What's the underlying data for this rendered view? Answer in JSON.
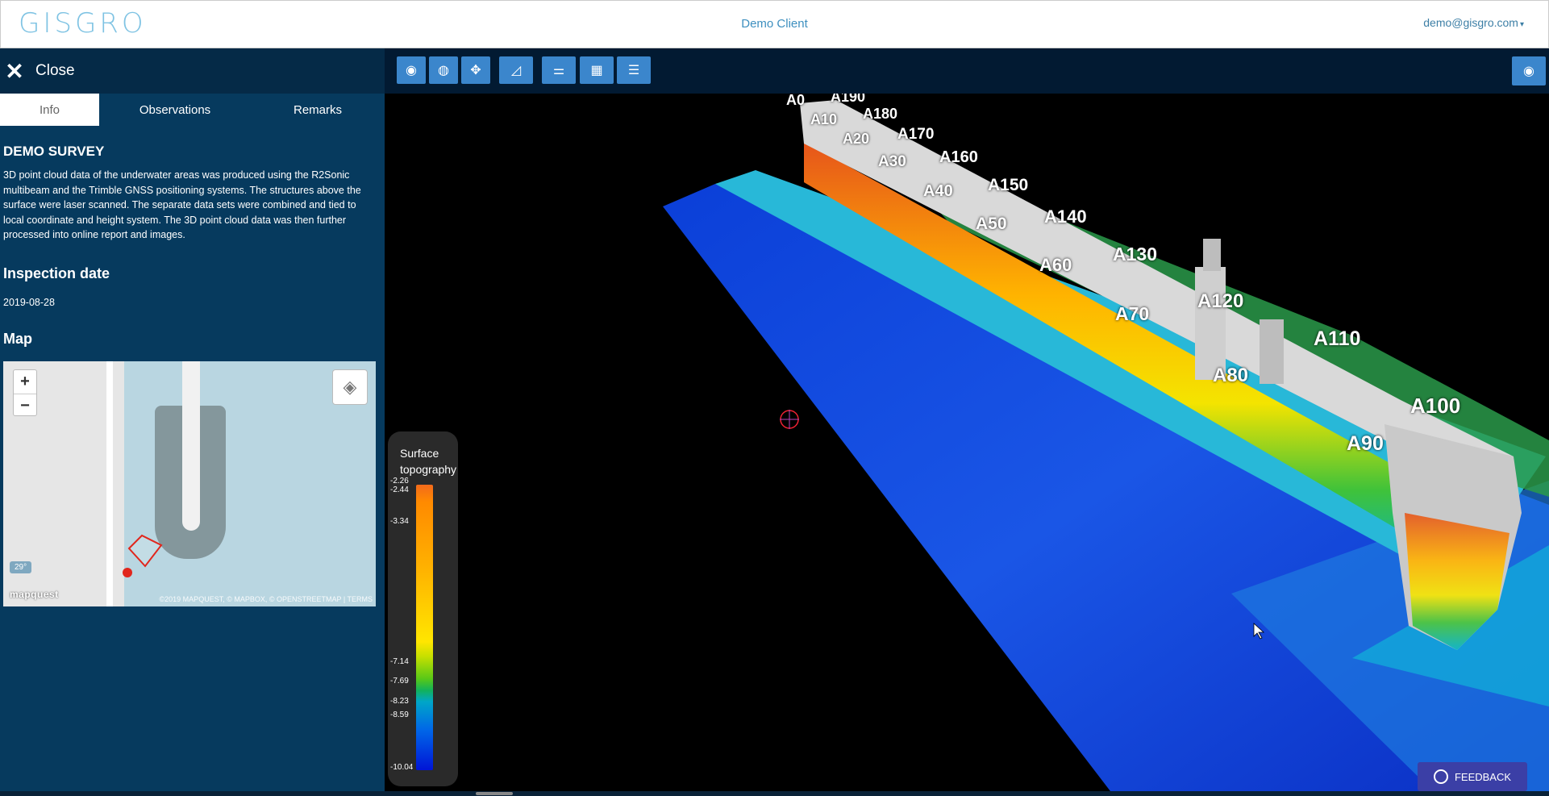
{
  "header": {
    "logo": "GISGRO",
    "client": "Demo Client",
    "user": "demo@gisgro.com"
  },
  "sidebar": {
    "close_label": "Close",
    "tabs": [
      {
        "label": "Info",
        "active": true
      },
      {
        "label": "Observations",
        "active": false
      },
      {
        "label": "Remarks",
        "active": false
      }
    ],
    "survey_title": "DEMO SURVEY",
    "survey_description": "3D point cloud data of the underwater areas was produced using the R2Sonic multibeam and the Trimble GNSS positioning systems. The structures above the surface were laser scanned. The separate data sets were combined and tied to local coordinate and height system. The 3D point cloud data was then further processed into online report and images.",
    "inspection_heading": "Inspection date",
    "inspection_date": "2019-08-28",
    "map_heading": "Map",
    "map": {
      "zoom_in": "+",
      "zoom_out": "−",
      "scale_badge": "29°",
      "provider_logo": "mapquest",
      "attribution": "©2019 MAPQUEST, © MAPBOX, © OPENSTREETMAP | TERMS"
    }
  },
  "toolbar": {
    "buttons": [
      "camera-icon",
      "globe-icon",
      "move-icon",
      "measure-icon",
      "sliders-icon",
      "image-icon",
      "list-icon"
    ],
    "right_button": "eye-icon"
  },
  "viewport": {
    "labels": [
      "A0",
      "A190",
      "A10",
      "A180",
      "A20",
      "A170",
      "A30",
      "A160",
      "A40",
      "A150",
      "A50",
      "A140",
      "A60",
      "A130",
      "A70",
      "A120",
      "A80",
      "A110",
      "A90",
      "A100"
    ]
  },
  "legend": {
    "title_line1": "Surface",
    "title_line2": "topography",
    "ticks": [
      "-2.26",
      "-2.44",
      "-3.34",
      "-7.14",
      "-7.69",
      "-8.23",
      "-8.59",
      "-10.04"
    ],
    "colors": {
      "top": "#f26a1b",
      "mid": "#ffe600",
      "green": "#58c817",
      "bottom": "#0014d6"
    }
  },
  "feedback_label": "FEEDBACK"
}
